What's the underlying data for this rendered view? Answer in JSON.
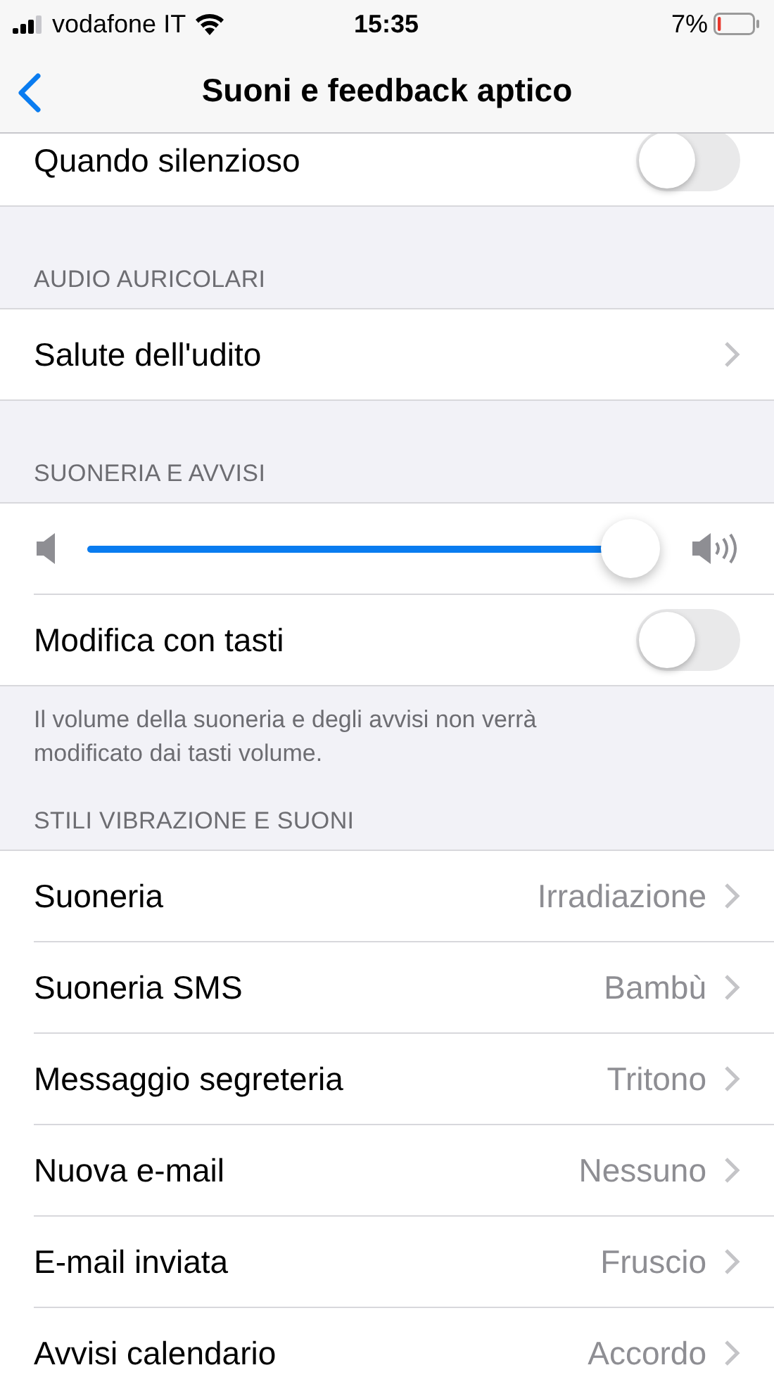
{
  "status_bar": {
    "carrier": "vodafone IT",
    "time": "15:35",
    "battery": "7%"
  },
  "nav": {
    "title": "Suoni e feedback aptico"
  },
  "sections": [
    {
      "rows": [
        {
          "kind": "toggle",
          "label": "Quando silenzioso",
          "on": false
        }
      ]
    },
    {
      "header": "AUDIO AURICOLARI",
      "rows": [
        {
          "kind": "link",
          "label": "Salute dell'udito"
        }
      ]
    },
    {
      "header": "SUONERIA E AVVISI",
      "rows": [
        {
          "kind": "slider",
          "level": 0.95
        },
        {
          "kind": "toggle",
          "label": "Modifica con tasti",
          "on": false
        }
      ],
      "footer": "Il volume della suoneria e degli avvisi non verrà modificato dai tasti volume."
    },
    {
      "header": "STILI VIBRAZIONE E SUONI",
      "rows": [
        {
          "kind": "link",
          "label": "Suoneria",
          "value": "Irradiazione"
        },
        {
          "kind": "link",
          "label": "Suoneria SMS",
          "value": "Bambù"
        },
        {
          "kind": "link",
          "label": "Messaggio segreteria",
          "value": "Tritono"
        },
        {
          "kind": "link",
          "label": "Nuova e-mail",
          "value": "Nessuno"
        },
        {
          "kind": "link",
          "label": "E-mail inviata",
          "value": "Fruscio"
        },
        {
          "kind": "link",
          "label": "Avvisi calendario",
          "value": "Accordo"
        }
      ]
    }
  ]
}
